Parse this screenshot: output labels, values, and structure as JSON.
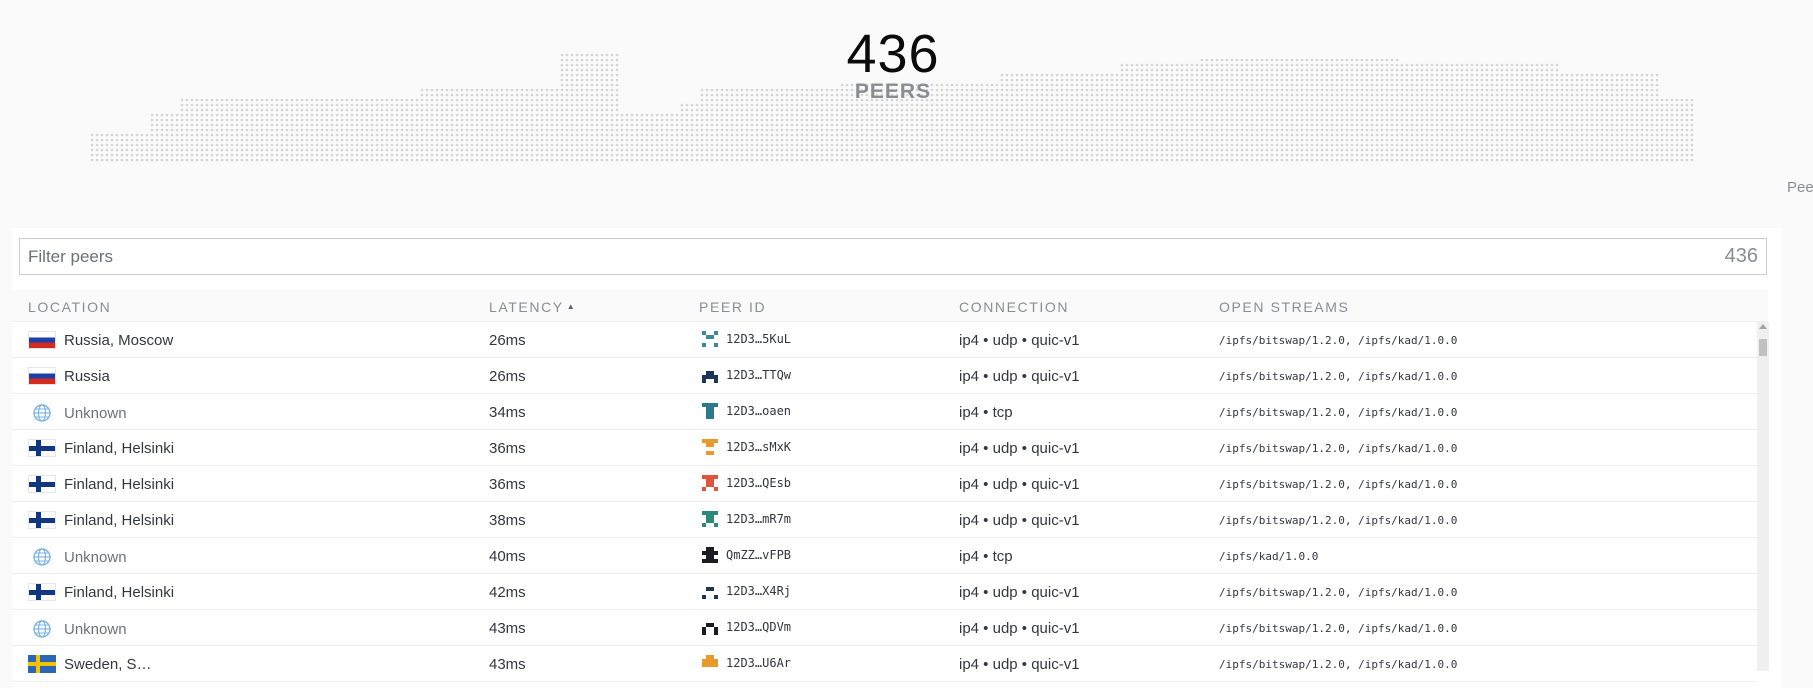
{
  "hero": {
    "count": "436",
    "label": "PEERS"
  },
  "side_label": "Pee",
  "filter": {
    "placeholder": "Filter peers",
    "count": "436"
  },
  "columns": {
    "location": "LOCATION",
    "latency": "LATENCY",
    "peer_id": "PEER ID",
    "connection": "CONNECTION",
    "open_streams": "OPEN STREAMS"
  },
  "rows": [
    {
      "flag": "ru",
      "location": "Russia, Moscow",
      "latency": "26ms",
      "peer_id": "12D3…5KuL",
      "icon_color": "#3a8a9a",
      "connection": "ip4 • udp • quic-v1",
      "streams": "/ipfs/bitswap/1.2.0, /ipfs/kad/1.0.0"
    },
    {
      "flag": "ru",
      "location": "Russia",
      "latency": "26ms",
      "peer_id": "12D3…TTQw",
      "icon_color": "#1d3557",
      "connection": "ip4 • udp • quic-v1",
      "streams": "/ipfs/bitswap/1.2.0, /ipfs/kad/1.0.0"
    },
    {
      "flag": "unknown",
      "location": "Unknown",
      "latency": "34ms",
      "peer_id": "12D3…oaen",
      "icon_color": "#2b7a8a",
      "connection": "ip4 • tcp",
      "streams": "/ipfs/bitswap/1.2.0, /ipfs/kad/1.0.0"
    },
    {
      "flag": "fi",
      "location": "Finland, Helsinki",
      "latency": "36ms",
      "peer_id": "12D3…sMxK",
      "icon_color": "#e89a2c",
      "connection": "ip4 • udp • quic-v1",
      "streams": "/ipfs/bitswap/1.2.0, /ipfs/kad/1.0.0"
    },
    {
      "flag": "fi",
      "location": "Finland, Helsinki",
      "latency": "36ms",
      "peer_id": "12D3…QEsb",
      "icon_color": "#e0543c",
      "connection": "ip4 • udp • quic-v1",
      "streams": "/ipfs/bitswap/1.2.0, /ipfs/kad/1.0.0"
    },
    {
      "flag": "fi",
      "location": "Finland, Helsinki",
      "latency": "38ms",
      "peer_id": "12D3…mR7m",
      "icon_color": "#2b8a7a",
      "connection": "ip4 • udp • quic-v1",
      "streams": "/ipfs/bitswap/1.2.0, /ipfs/kad/1.0.0"
    },
    {
      "flag": "unknown",
      "location": "Unknown",
      "latency": "40ms",
      "peer_id": "QmZZ…vFPB",
      "icon_color": "#1b1d22",
      "connection": "ip4 • tcp",
      "streams": "/ipfs/kad/1.0.0"
    },
    {
      "flag": "fi",
      "location": "Finland, Helsinki",
      "latency": "42ms",
      "peer_id": "12D3…X4Rj",
      "icon_color": "#1d3557",
      "connection": "ip4 • udp • quic-v1",
      "streams": "/ipfs/bitswap/1.2.0, /ipfs/kad/1.0.0"
    },
    {
      "flag": "unknown",
      "location": "Unknown",
      "latency": "43ms",
      "peer_id": "12D3…QDVm",
      "icon_color": "#1b1d22",
      "connection": "ip4 • udp • quic-v1",
      "streams": "/ipfs/bitswap/1.2.0, /ipfs/kad/1.0.0"
    },
    {
      "flag": "se",
      "location": "Sweden, S…",
      "latency": "43ms",
      "peer_id": "12D3…U6Ar",
      "icon_color": "#e89a2c",
      "connection": "ip4 • udp • quic-v1",
      "streams": "/ipfs/bitswap/1.2.0, /ipfs/kad/1.0.0"
    }
  ]
}
